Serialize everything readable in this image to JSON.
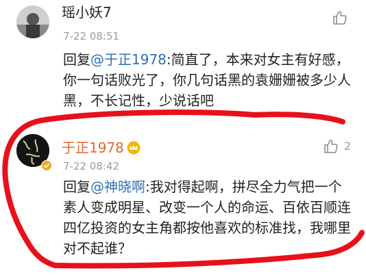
{
  "comments": [
    {
      "username": "瑶小妖7",
      "time": "7-22 08:51",
      "reply_prefix": "回复",
      "mention": "@于正1978",
      "text": ":简直了，本来对女主有好感，你一句话败光了，你几句话黑的袁姗姗被多少人黑，不长记性，少说话吧"
    },
    {
      "username": "于正1978",
      "time": "7-22 08:42",
      "like_count": "2",
      "reply_prefix": "回复",
      "mention": "@神晓啊",
      "text": ":我对得起啊，拼尽全力气把一个素人变成明星、改变一个人的命运、百依百顺连四亿投资的女主角都按他喜欢的标准找，我哪里对不起谁？"
    }
  ],
  "colors": {
    "username_vip": "#e8652d",
    "mention": "#2f6fb6",
    "time": "#9b9b9b",
    "scribble": "#e8101a"
  },
  "icons": [
    "avatar",
    "like-icon",
    "vip-crown-icon",
    "verified-badge-icon"
  ]
}
